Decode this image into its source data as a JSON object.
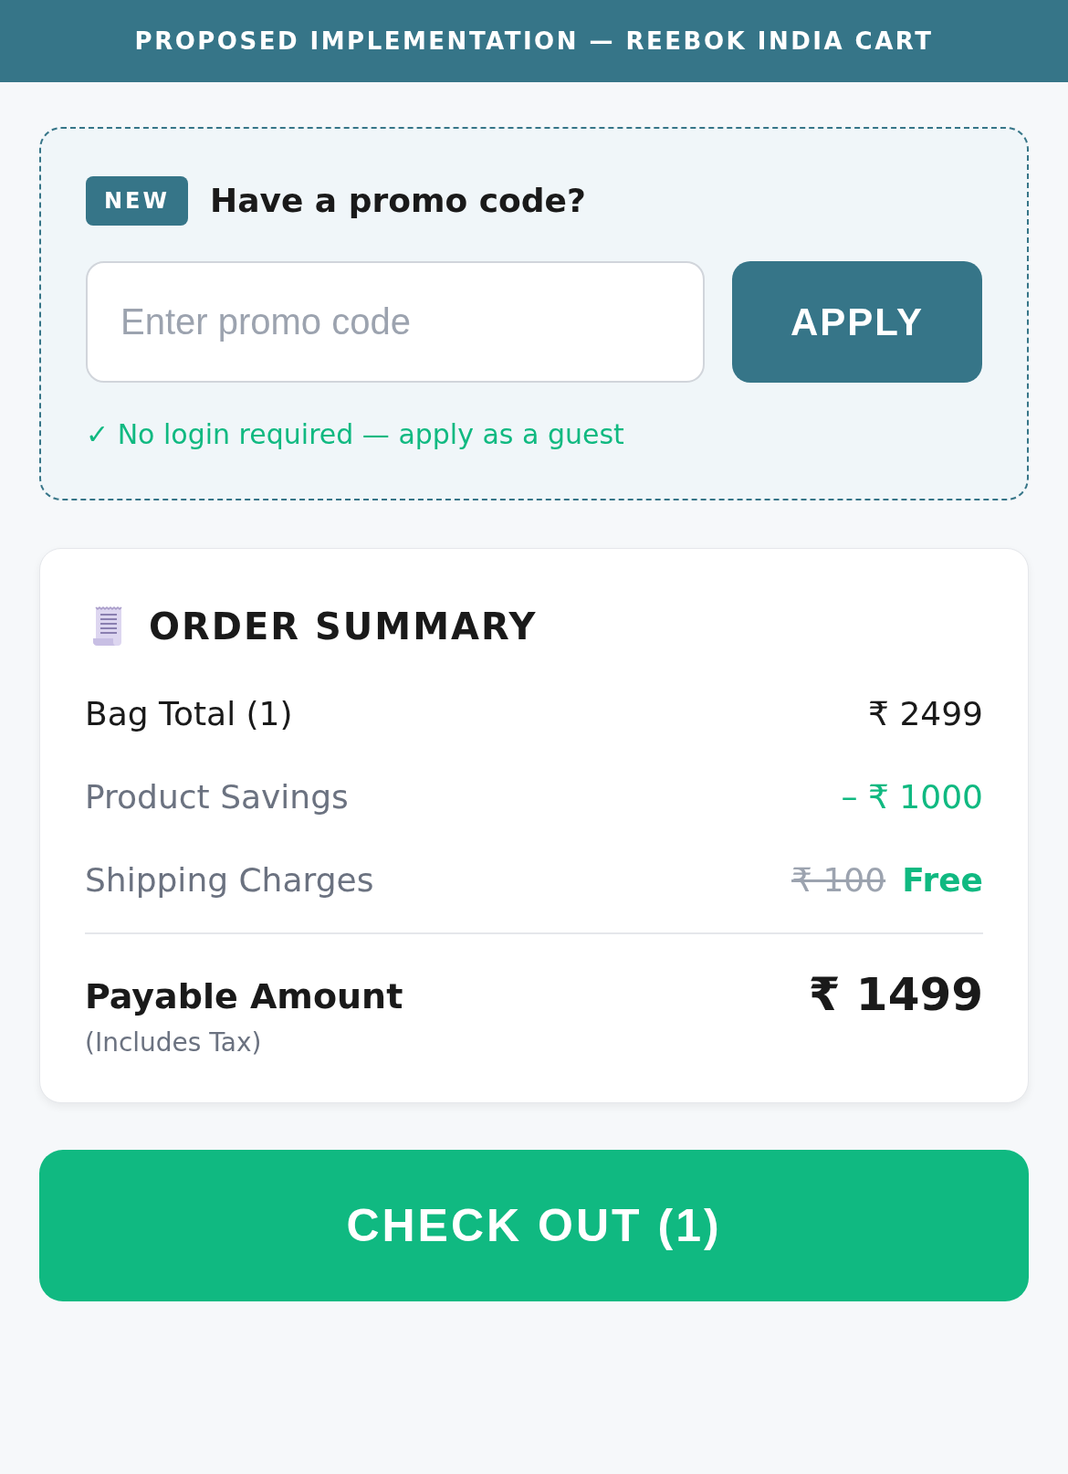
{
  "header": {
    "title": "PROPOSED IMPLEMENTATION — REEBOK INDIA CART"
  },
  "promo": {
    "badge": "NEW",
    "heading": "Have a promo code?",
    "input": {
      "placeholder": "Enter promo code"
    },
    "apply_button": "APPLY",
    "note": "✓ No login required — apply as a guest"
  },
  "order_summary": {
    "title": "ORDER SUMMARY",
    "rows": [
      {
        "kind": "plain",
        "label": "Bag Total (1)",
        "value": "₹ 2499"
      },
      {
        "kind": "savings",
        "label": "Product Savings",
        "value": "– ₹ 1000"
      },
      {
        "kind": "shipping",
        "label": "Shipping Charges",
        "old_value": "₹ 100",
        "value": "Free"
      }
    ],
    "total": {
      "label": "Payable Amount",
      "sublabel": "(Includes Tax)",
      "value": "₹ 1499"
    }
  },
  "checkout_button": "CHECK OUT (1)"
}
